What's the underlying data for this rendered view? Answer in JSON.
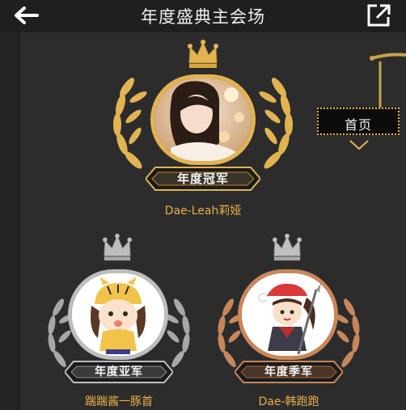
{
  "header": {
    "title": "年度盛典主会场",
    "back_icon": "back-arrow-icon",
    "share_icon": "share-external-icon"
  },
  "sign": {
    "label": "首页"
  },
  "winners": [
    {
      "rank_label": "年度冠军",
      "name": "Dae-Leah莉娅",
      "tier": "gold"
    },
    {
      "rank_label": "年度亚军",
      "name": "踹踹酱一豚首",
      "tier": "silver"
    },
    {
      "rank_label": "年度季军",
      "name": "Dae-韩跑跑",
      "tier": "bronze"
    }
  ],
  "colors": {
    "gold": "#e2b451",
    "silver": "#bdbdbd",
    "bronze": "#c8875a",
    "name": "#e8b04a",
    "background": "#2c2c2c"
  }
}
